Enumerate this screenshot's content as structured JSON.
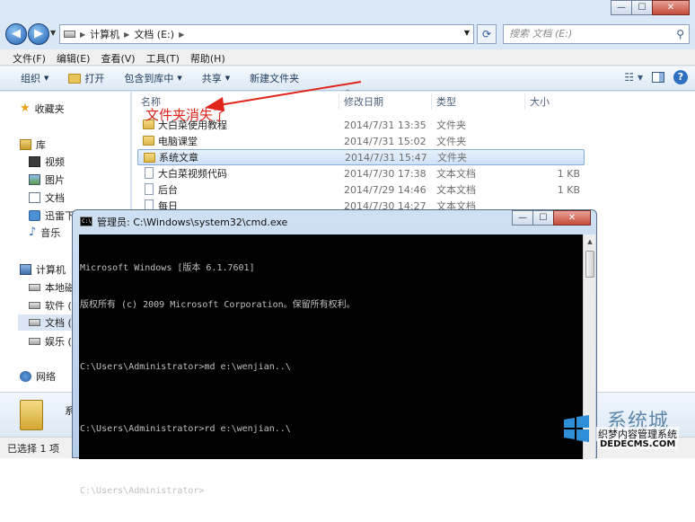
{
  "explorer": {
    "window_buttons": {
      "minimize": "—",
      "maximize": "☐",
      "close": "✕"
    },
    "address": {
      "crumbs": [
        "计算机",
        "文档 (E:)"
      ]
    },
    "search": {
      "placeholder": "搜索 文档 (E:)"
    },
    "menu": [
      "文件(F)",
      "编辑(E)",
      "查看(V)",
      "工具(T)",
      "帮助(H)"
    ],
    "toolbar": {
      "organize": "组织",
      "open": "打开",
      "include_in_library": "包含到库中",
      "share": "共享",
      "new_folder": "新建文件夹"
    },
    "nav": {
      "favorites": "收藏夹",
      "libraries": "库",
      "video": "视频",
      "pictures": "图片",
      "documents": "文档",
      "thunder": "迅雷下",
      "music": "音乐",
      "computer": "计算机",
      "local_disk": "本地磁",
      "software": "软件 (",
      "docs_drive": "文档 (",
      "entertainment": "娱乐 (",
      "network": "网络"
    },
    "columns": {
      "name": "名称",
      "date": "修改日期",
      "type": "类型",
      "size": "大小"
    },
    "files": [
      {
        "name": "大白菜使用教程",
        "date": "2014/7/31 13:35",
        "type": "文件夹",
        "size": "",
        "icon": "folder-icon"
      },
      {
        "name": "电脑课堂",
        "date": "2014/7/31 15:02",
        "type": "文件夹",
        "size": "",
        "icon": "folder-icon"
      },
      {
        "name": "系统文章",
        "date": "2014/7/31 15:47",
        "type": "文件夹",
        "size": "",
        "icon": "folder-icon"
      },
      {
        "name": "大白菜视频代码",
        "date": "2014/7/30 17:38",
        "type": "文本文档",
        "size": "1 KB",
        "icon": "txt-icon"
      },
      {
        "name": "后台",
        "date": "2014/7/29 14:46",
        "type": "文本文档",
        "size": "1 KB",
        "icon": "txt-icon"
      },
      {
        "name": "每日",
        "date": "2014/7/30 14:27",
        "type": "文本文档",
        "size": "",
        "icon": "txt-icon"
      }
    ],
    "annotation": "文件夹消失了",
    "details": {
      "name": "系"
    },
    "status": "已选择 1 项"
  },
  "cmd": {
    "title": "管理员: C:\\Windows\\system32\\cmd.exe",
    "icon_label": "C:\\",
    "lines": [
      "Microsoft Windows [版本 6.1.7601]",
      "版权所有 (c) 2009 Microsoft Corporation。保留所有权利。",
      "",
      "C:\\Users\\Administrator>md e:\\wenjian..\\",
      "",
      "C:\\Users\\Administrator>rd e:\\wenjian..\\",
      "",
      "C:\\Users\\Administrator>"
    ]
  },
  "watermark": {
    "brand": "系统城",
    "line1": "织梦内容管理系统",
    "line2": "DEDECMS.COM"
  },
  "colors": {
    "annotation": "#e0241b",
    "cmd_bg": "#000000",
    "cmd_text": "#c0c0c0",
    "accent": "#2e6fc1"
  }
}
